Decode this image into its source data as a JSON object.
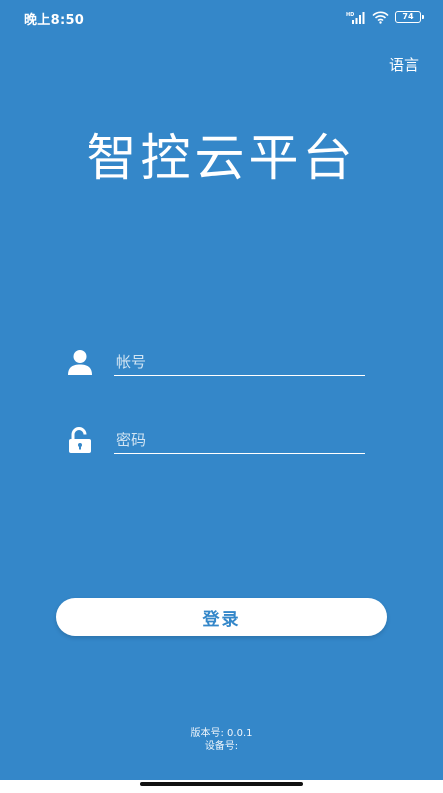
{
  "status_bar": {
    "time": "晚上8:50",
    "hd_label": "HD",
    "battery_level": "74",
    "icons": [
      "signal-icon",
      "wifi-icon",
      "battery-icon"
    ]
  },
  "header": {
    "language_label": "语言"
  },
  "app": {
    "title": "智控云平台"
  },
  "form": {
    "account": {
      "placeholder": "帐号",
      "value": ""
    },
    "password": {
      "placeholder": "密码",
      "value": ""
    },
    "login_label": "登录"
  },
  "footer": {
    "version": "版本号: 0.0.1",
    "device": "设备号:"
  },
  "colors": {
    "background": "#3487c9",
    "button_background": "#ffffff",
    "button_text": "#3487c9"
  }
}
